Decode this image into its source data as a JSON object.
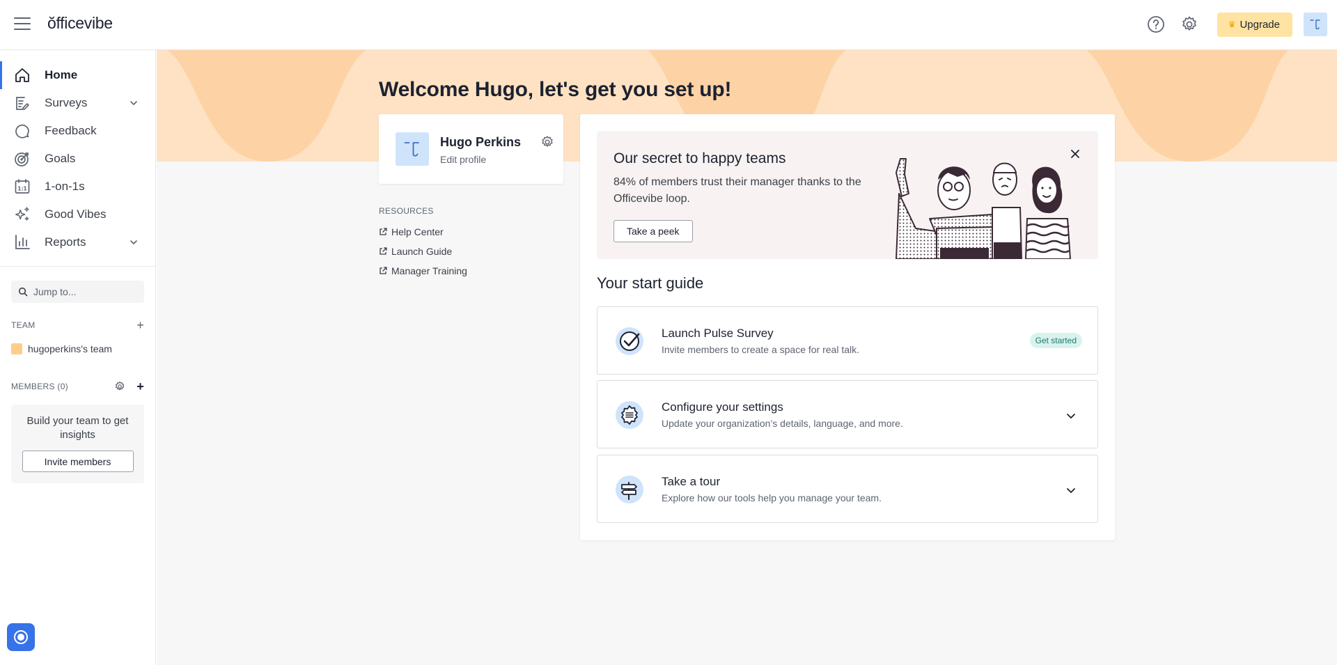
{
  "header": {
    "logo": "ŏfficevibe",
    "upgrade_label": "Upgrade",
    "icons": {
      "menu": "hamburger-menu-icon",
      "help": "question-circle-icon",
      "settings": "gear-icon",
      "crown": "crown-icon"
    }
  },
  "sidebar": {
    "items": [
      {
        "label": "Home",
        "icon": "home-icon",
        "active": true
      },
      {
        "label": "Surveys",
        "icon": "survey-icon",
        "expandable": true
      },
      {
        "label": "Feedback",
        "icon": "speech-bubble-icon"
      },
      {
        "label": "Goals",
        "icon": "target-icon"
      },
      {
        "label": "1-on-1s",
        "icon": "calendar-icon"
      },
      {
        "label": "Good Vibes",
        "icon": "sparkles-icon"
      },
      {
        "label": "Reports",
        "icon": "bar-chart-icon",
        "expandable": true
      }
    ],
    "jump_placeholder": "Jump to...",
    "team_heading": "TEAM",
    "team_name": "hugoperkins's team",
    "members_heading": "MEMBERS (0)",
    "members_text": "Build your team to get insights",
    "invite_label": "Invite members"
  },
  "main": {
    "welcome": "Welcome Hugo, let's get you set up!",
    "profile": {
      "name": "Hugo Perkins",
      "edit_label": "Edit profile"
    },
    "resources": {
      "title": "RESOURCES",
      "links": [
        "Help Center",
        "Launch Guide",
        "Manager Training"
      ]
    },
    "promo": {
      "title": "Our secret to happy teams",
      "text": "84% of members trust their manager thanks to the Officevibe loop.",
      "button": "Take a peek"
    },
    "guide": {
      "title": "Your start guide",
      "items": [
        {
          "name": "Launch Pulse Survey",
          "desc": "Invite members to create a space for real talk.",
          "badge": "Get started",
          "icon": "checkmark-circle-icon"
        },
        {
          "name": "Configure your settings",
          "desc": "Update your organization’s details, language, and more.",
          "icon": "settings-badge-icon"
        },
        {
          "name": "Take a tour",
          "desc": "Explore how our tools help you manage your team.",
          "icon": "signpost-icon"
        }
      ]
    }
  },
  "colors": {
    "accent": "#3672e8",
    "hero_light": "#fee2c3",
    "hero_dark": "#fdd3a6",
    "upgrade_bg": "#ffe3a3",
    "avatar_bg": "#cfe3fb",
    "badge_bg": "#d8f3ee"
  }
}
